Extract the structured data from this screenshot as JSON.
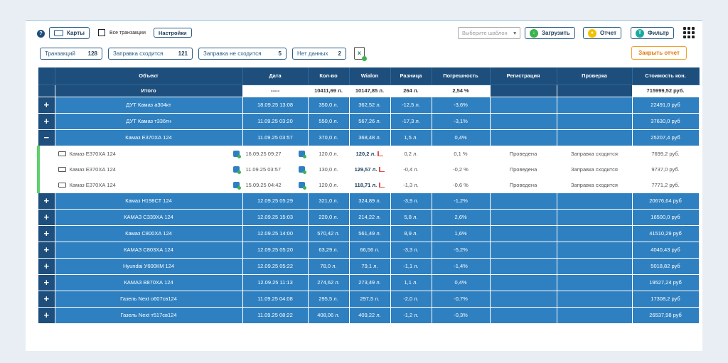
{
  "toolbar": {
    "help_icon": "?",
    "maps_label": "Карты",
    "all_tx_label": "Все транзакции",
    "settings_label": "Настройки",
    "template_placeholder": "Выберите шаблон",
    "upload_label": "Загрузить",
    "report_label": "Отчет",
    "filter_label": "Фильтр",
    "close_report_label": "Закрыть отчет"
  },
  "stats": [
    {
      "label": "Транзакций",
      "value": "128"
    },
    {
      "label": "Заправка сходится",
      "value": "121"
    },
    {
      "label": "Заправка не сходится",
      "value": "5"
    },
    {
      "label": "Нет данных",
      "value": "2"
    }
  ],
  "columns": [
    "Объект",
    "Дата",
    "Кол-во",
    "Wialon",
    "Разница",
    "Погрешность",
    "Регистрация",
    "Проверка",
    "Стоимость кон."
  ],
  "total": {
    "label": "Итого",
    "date": "-----",
    "qty": "10411,69 л.",
    "wialon": "10147,85 л.",
    "diff": "264 л.",
    "err": "2,54 %",
    "cost": "715999,52 руб."
  },
  "rows_top": [
    {
      "obj": "ДУТ Камаз а304кт",
      "date": "18.09.25 13:08",
      "qty": "350,0 л.",
      "wialon": "362,52 л.",
      "diff": "-12,5 л.",
      "err": "-3,6%",
      "cost": "22491,0 руб"
    },
    {
      "obj": "ДУТ Камаз т336тн",
      "date": "11.09.25 03:20",
      "qty": "550,0 л.",
      "wialon": "567,26 л.",
      "diff": "-17,3 л.",
      "err": "-3,1%",
      "cost": "37630,0 руб"
    },
    {
      "obj": "Камаз Е370ХА 124",
      "date": "11.09.25 03:57",
      "qty": "370,0 л.",
      "wialon": "368,48 л.",
      "diff": "1,5 л.",
      "err": "0,4%",
      "cost": "25207,4 руб"
    }
  ],
  "sub_rows": [
    {
      "obj": "Камаз Е370ХА 124",
      "date": "16.09.25 09:27",
      "qty": "120,0 л.",
      "wialon": "120,2 л.",
      "diff": "0,2 л.",
      "err": "0,1 %",
      "reg": "Проведена",
      "check": "Заправка сходится",
      "cost": "7699,2 руб."
    },
    {
      "obj": "Камаз Е370ХА 124",
      "date": "11.09.25 03:57",
      "qty": "130,0 л.",
      "wialon": "129,57 л.",
      "diff": "-0,4 л.",
      "err": "-0,2 %",
      "reg": "Проведена",
      "check": "Заправка сходится",
      "cost": "9737,0 руб."
    },
    {
      "obj": "Камаз Е370ХА 124",
      "date": "15.09.25 04:42",
      "qty": "120,0 л.",
      "wialon": "118,71 л.",
      "diff": "-1,3 л.",
      "err": "-0,6 %",
      "reg": "Проведена",
      "check": "Заправка сходится",
      "cost": "7771,2 руб."
    }
  ],
  "rows_bottom": [
    {
      "obj": "Камаз Н198СТ 124",
      "date": "12.09.25 05:29",
      "qty": "321,0 л.",
      "wialon": "324,89 л.",
      "diff": "-3,9 л.",
      "err": "-1,2%",
      "cost": "20676,64 руб"
    },
    {
      "obj": "КАМАЗ С339ХА 124",
      "date": "12.09.25 15:03",
      "qty": "220,0 л.",
      "wialon": "214,22 л.",
      "diff": "5,8 л.",
      "err": "2,6%",
      "cost": "16500,0 руб"
    },
    {
      "obj": "Камаз С800ХА 124",
      "date": "12.09.25 14:00",
      "qty": "570,42 л.",
      "wialon": "561,49 л.",
      "diff": "8,9 л.",
      "err": "1,6%",
      "cost": "41510,29 руб"
    },
    {
      "obj": "КАМАЗ С803ХА 124",
      "date": "12.09.25 05:20",
      "qty": "63,29 л.",
      "wialon": "66,56 л.",
      "diff": "-3,3 л.",
      "err": "-5,2%",
      "cost": "4040,43 руб"
    },
    {
      "obj": "Hyundai У600КМ 124",
      "date": "12.09.25 05:22",
      "qty": "78,0 л.",
      "wialon": "79,1 л.",
      "diff": "-1,1 л.",
      "err": "-1,4%",
      "cost": "5018,82 руб"
    },
    {
      "obj": "КАМАЗ В870ХА 124",
      "date": "12.09.25 11:13",
      "qty": "274,62 л.",
      "wialon": "273,49 л.",
      "diff": "1,1 л.",
      "err": "0,4%",
      "cost": "19527,24 руб"
    },
    {
      "obj": "Газель Next о607св124",
      "date": "11.09.25 04:08",
      "qty": "295,5 л.",
      "wialon": "297,5 л.",
      "diff": "-2,0 л.",
      "err": "-0,7%",
      "cost": "17308,2 руб"
    },
    {
      "obj": "Газель Next т517св124",
      "date": "11.09.25 08:22",
      "qty": "408,06 л.",
      "wialon": "409,22 л.",
      "diff": "-1,2 л.",
      "err": "-0,3%",
      "cost": "26537,98 руб"
    }
  ],
  "expand_icons": {
    "plus": "+",
    "minus": "−"
  },
  "colors": {
    "header": "#1d4e7c",
    "row": "#2f80c0",
    "accent_green": "#3cb44b",
    "accent_orange": "#f0a030"
  }
}
